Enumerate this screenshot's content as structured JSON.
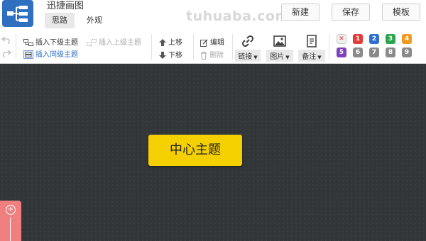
{
  "app": {
    "title": "迅捷画图"
  },
  "tabs": [
    {
      "label": "思路"
    },
    {
      "label": "外观"
    }
  ],
  "header_buttons": {
    "new": "新建",
    "save": "保存",
    "template": "模板"
  },
  "watermark": "tuhuaba.com",
  "toolbar": {
    "insert_child": "插入下级主题",
    "insert_parent": "插入上级主题",
    "insert_sibling": "插入同级主题",
    "move_up": "上移",
    "move_down": "下移",
    "edit": "编辑",
    "delete": "删除",
    "link": "链接",
    "image": "图片",
    "note": "备注"
  },
  "priority_badges": [
    {
      "label": "✕",
      "color": "#f0f0f0",
      "text_color": "#d33"
    },
    {
      "label": "1",
      "color": "#e23b3b"
    },
    {
      "label": "2",
      "color": "#2c6fd0"
    },
    {
      "label": "3",
      "color": "#2aa44a"
    },
    {
      "label": "4",
      "color": "#f09a20"
    },
    {
      "label": "5",
      "color": "#7f3fbf"
    },
    {
      "label": "6",
      "color": "#8a8a8a"
    },
    {
      "label": "7",
      "color": "#8a8a8a"
    },
    {
      "label": "8",
      "color": "#8a8a8a"
    },
    {
      "label": "9",
      "color": "#8a8a8a"
    }
  ],
  "canvas": {
    "central_topic": "中心主题",
    "background": "#333638",
    "topic_color": "#f5d000"
  },
  "zoom": {
    "plus": "+"
  }
}
